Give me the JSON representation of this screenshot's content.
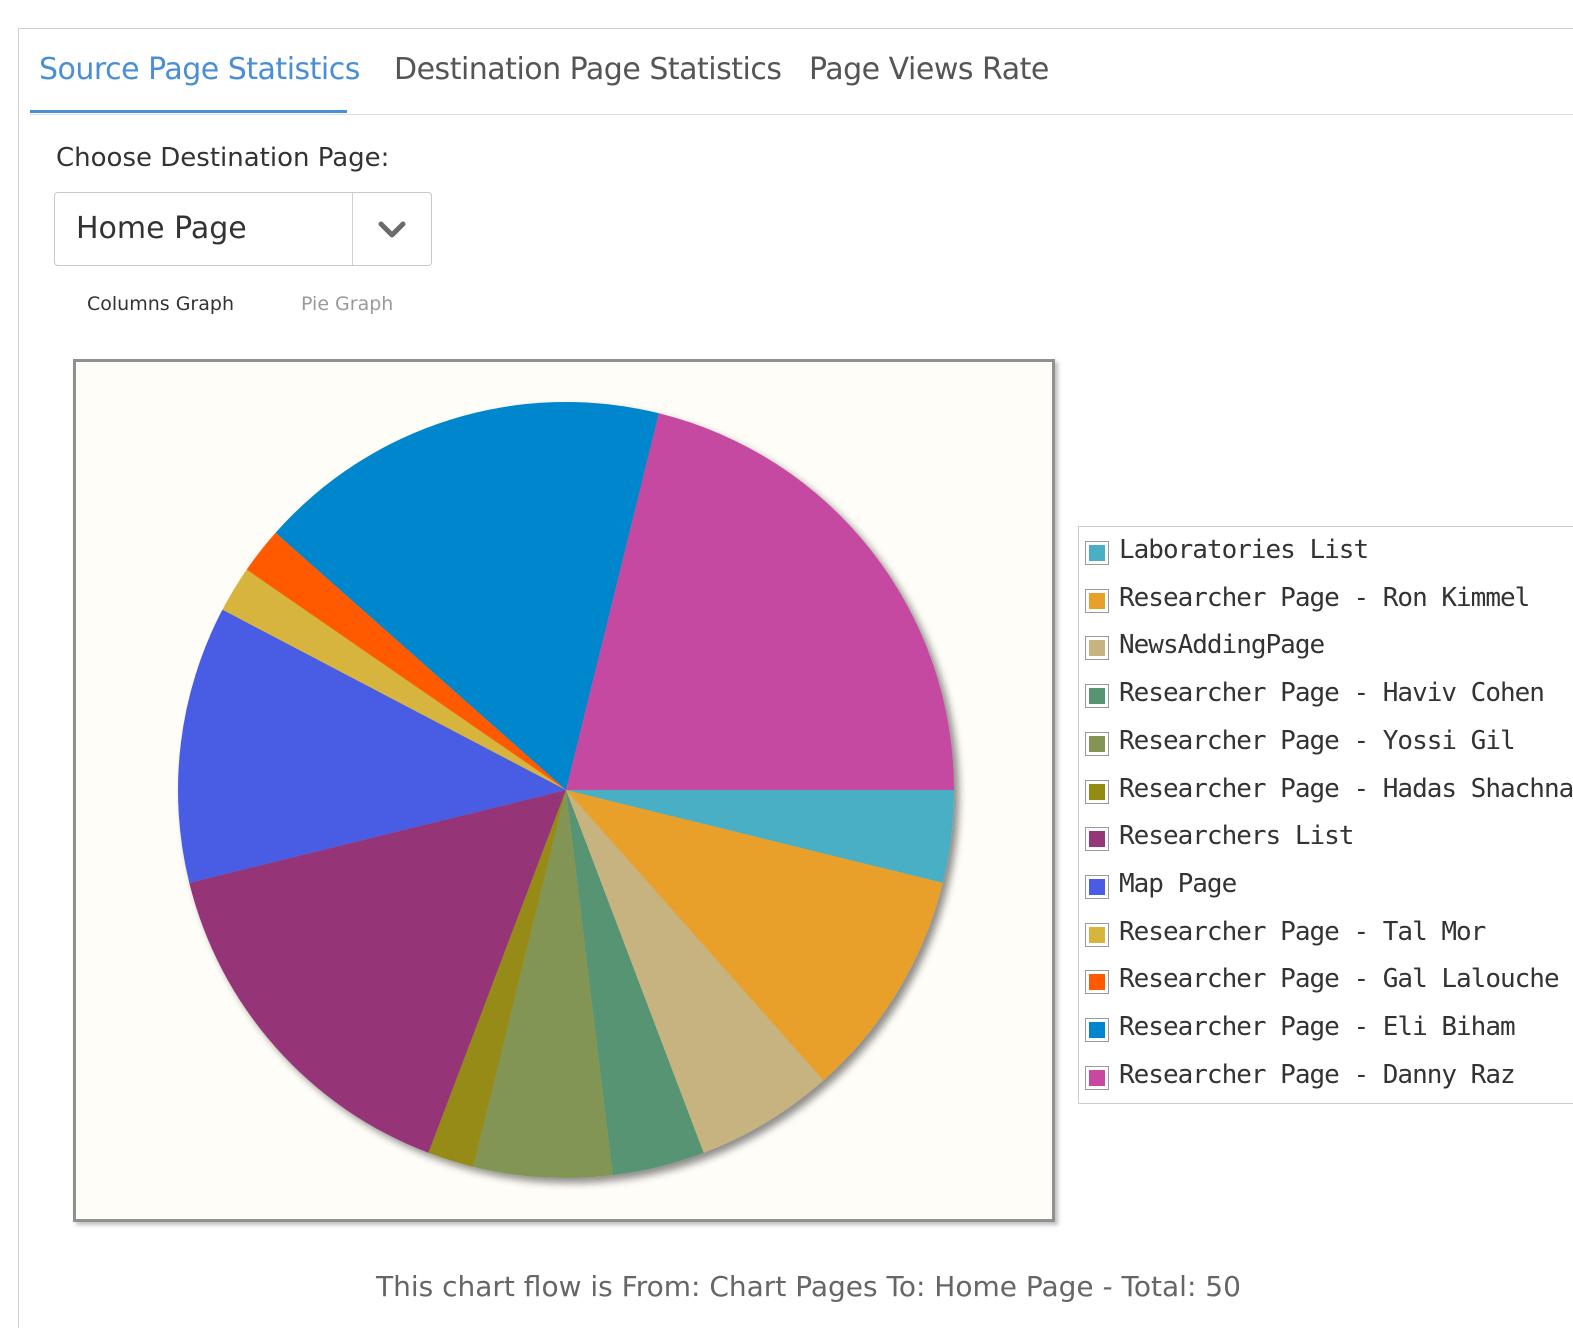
{
  "tabs": [
    {
      "label": "Source Page Statistics",
      "active": true
    },
    {
      "label": "Destination Page Statistics",
      "active": false
    },
    {
      "label": "Page Views Rate",
      "active": false
    }
  ],
  "destination": {
    "label": "Choose Destination Page:",
    "selected": "Home Page"
  },
  "graph_switch": {
    "columns_label": "Columns Graph",
    "pie_label": "Pie Graph"
  },
  "footer": {
    "text": "This chart flow is From: Chart Pages To: Home Page - Total: 50"
  },
  "colors": {
    "accent": "#4a8fd6"
  },
  "icons": {
    "select_arrow": "chevron-down-icon"
  },
  "chart_data": {
    "type": "pie",
    "categories": [
      "Laboratories List",
      "Researcher Page - Ron Kimmel",
      "NewsAddingPage",
      "Researcher Page - Haviv Cohen",
      "Researcher Page - Yossi Gil",
      "Researcher Page - Hadas Shachnai",
      "Researchers List",
      "Map Page",
      "Researcher Page - Tal Mor",
      "Researcher Page - Gal Lalouche",
      "Researcher Page - Eli Biham",
      "Researcher Page - Danny Raz"
    ],
    "values": [
      2,
      5,
      3,
      2,
      3,
      1,
      8,
      6,
      1,
      1,
      9,
      11
    ],
    "colors": [
      "#4aafc4",
      "#e8a02a",
      "#c7b37f",
      "#579473",
      "#839555",
      "#958b12",
      "#953677",
      "#4a5be4",
      "#d7b43c",
      "#ff5a00",
      "#0086cc",
      "#c648a1"
    ],
    "legend": "right"
  }
}
